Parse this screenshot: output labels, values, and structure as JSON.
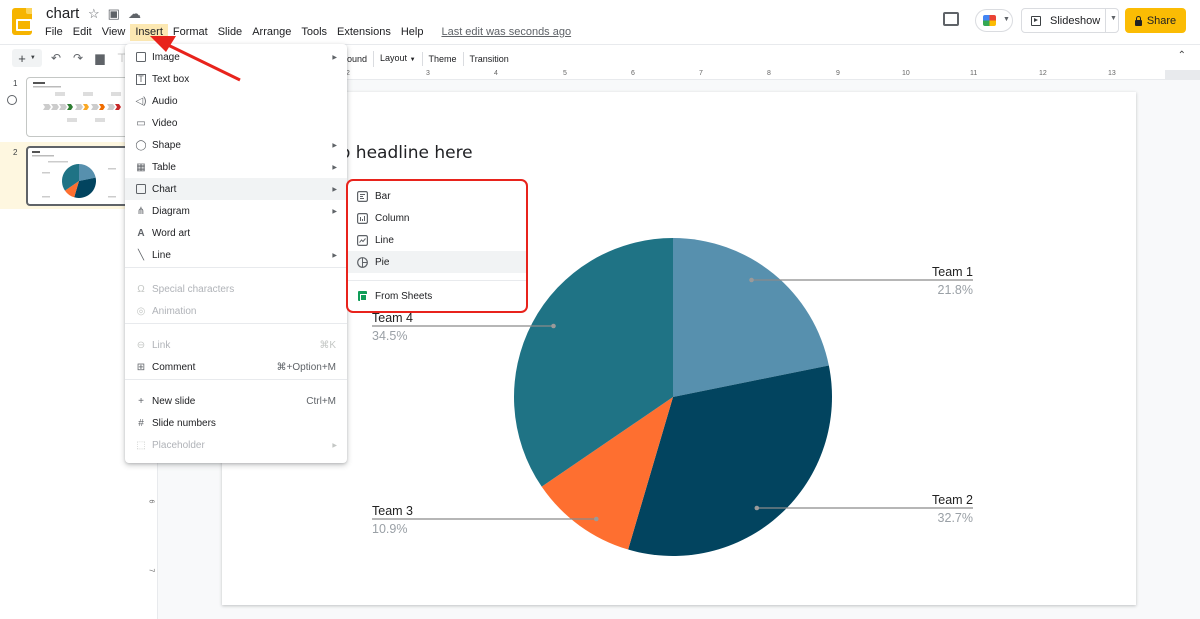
{
  "app": {
    "doc_title": "chart",
    "menu": [
      "File",
      "Edit",
      "View",
      "Insert",
      "Format",
      "Slide",
      "Arrange",
      "Tools",
      "Extensions",
      "Help"
    ],
    "active_menu": "Insert",
    "last_edit": "Last edit was seconds ago",
    "slideshow_label": "Slideshow",
    "share_label": "Share"
  },
  "toolbar": {
    "partial_background": "ound",
    "layout_label": "Layout",
    "theme_label": "Theme",
    "transition_label": "Transition"
  },
  "ruler": {
    "h_ticks": [
      "2",
      "3",
      "4",
      "5",
      "6",
      "7",
      "8",
      "9",
      "10",
      "11",
      "12",
      "13"
    ],
    "v_ticks": [
      "6",
      "7"
    ]
  },
  "filmstrip": {
    "slides": [
      {
        "number": "1",
        "selected": false
      },
      {
        "number": "2",
        "selected": true
      }
    ]
  },
  "slide": {
    "headline_visible": "o headline here"
  },
  "insert_menu": {
    "items": [
      {
        "label": "Image",
        "icon": "image-icon",
        "submenu": true,
        "disabled": false
      },
      {
        "label": "Text box",
        "icon": "text-box-icon",
        "submenu": false,
        "disabled": false
      },
      {
        "label": "Audio",
        "icon": "audio-icon",
        "submenu": false,
        "disabled": false
      },
      {
        "label": "Video",
        "icon": "video-icon",
        "submenu": false,
        "disabled": false
      },
      {
        "label": "Shape",
        "icon": "shape-icon",
        "submenu": true,
        "disabled": false
      },
      {
        "label": "Table",
        "icon": "table-icon",
        "submenu": true,
        "disabled": false
      },
      {
        "label": "Chart",
        "icon": "chart-icon",
        "submenu": true,
        "disabled": false,
        "highlighted": true
      },
      {
        "label": "Diagram",
        "icon": "diagram-icon",
        "submenu": true,
        "disabled": false
      },
      {
        "label": "Word art",
        "icon": "word-art-icon",
        "submenu": false,
        "disabled": false
      },
      {
        "label": "Line",
        "icon": "line-icon",
        "submenu": true,
        "disabled": false
      },
      {
        "label": "Special characters",
        "icon": "omega-icon",
        "submenu": false,
        "disabled": true
      },
      {
        "label": "Animation",
        "icon": "animation-icon",
        "submenu": false,
        "disabled": true
      },
      {
        "label": "Link",
        "icon": "link-icon",
        "shortcut": "⌘K",
        "disabled": true
      },
      {
        "label": "Comment",
        "icon": "comment-add-icon",
        "shortcut": "⌘+Option+M",
        "disabled": false
      },
      {
        "label": "New slide",
        "icon": "plus-icon",
        "shortcut": "Ctrl+M",
        "disabled": false
      },
      {
        "label": "Slide numbers",
        "icon": "hash-icon",
        "disabled": false
      },
      {
        "label": "Placeholder",
        "icon": "placeholder-icon",
        "submenu": true,
        "disabled": true
      }
    ]
  },
  "chart_submenu": {
    "items": [
      {
        "label": "Bar",
        "icon": "bar-chart-icon"
      },
      {
        "label": "Column",
        "icon": "column-chart-icon"
      },
      {
        "label": "Line",
        "icon": "line-chart-icon"
      },
      {
        "label": "Pie",
        "icon": "pie-chart-icon",
        "highlighted": true
      },
      {
        "label": "From Sheets",
        "icon": "sheets-icon"
      }
    ],
    "highlight_color": "#e8231c"
  },
  "chart_data": {
    "type": "pie",
    "title": "",
    "categories": [
      "Team 1",
      "Team 2",
      "Team 3",
      "Team 4"
    ],
    "values": [
      21.8,
      32.7,
      10.9,
      34.5
    ],
    "labels": [
      "21.8%",
      "32.7%",
      "10.9%",
      "34.5%"
    ],
    "colors": [
      "#5790ae",
      "#02445f",
      "#fe6f30",
      "#1f7385"
    ],
    "start_angle_deg": 0,
    "direction": "clockwise",
    "legend": "labeled-callouts"
  },
  "colors": {
    "accent": "#fbbc04",
    "annotation_red": "#e8231c"
  }
}
